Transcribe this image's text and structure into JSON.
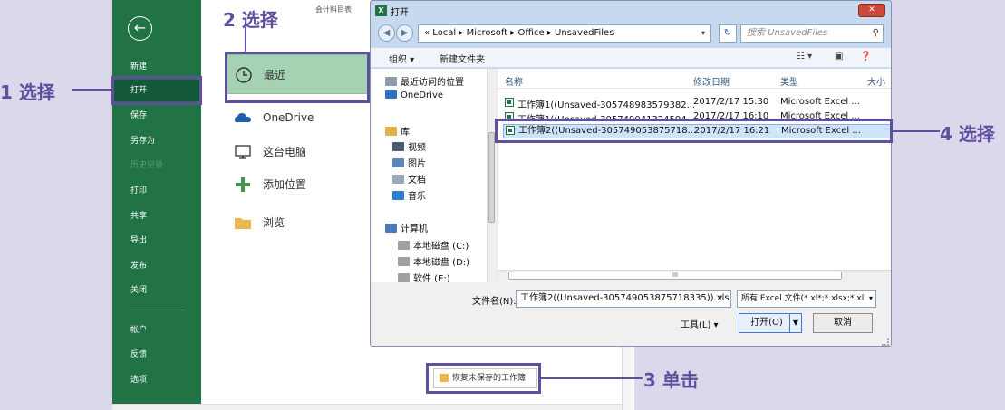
{
  "backstage": {
    "back_icon": "←",
    "nav": [
      "新建",
      "打开",
      "保存",
      "另存为",
      "历史记录",
      "打印",
      "共享",
      "导出",
      "发布",
      "关闭",
      "帐户",
      "反馈",
      "选项"
    ],
    "file_title": "会计科目表",
    "places": [
      {
        "label": "最近",
        "icon": "clock-icon"
      },
      {
        "label": "OneDrive",
        "icon": "cloud-icon"
      },
      {
        "label": "这台电脑",
        "icon": "computer-icon"
      },
      {
        "label": "添加位置",
        "icon": "plus-icon"
      },
      {
        "label": "浏览",
        "icon": "folder-icon"
      }
    ],
    "recover_button": "恢复未保存的工作簿"
  },
  "callouts": {
    "c1": "1 选择",
    "c2": "2 选择",
    "c3": "3 单击",
    "c4": "4 选择"
  },
  "dialog": {
    "title": "打开",
    "close": "✕",
    "address": "« Local ▸ Microsoft ▸ Office ▸ UnsavedFiles",
    "search_placeholder": "搜索 UnsavedFiles",
    "toolbar": {
      "organize": "组织 ▾",
      "new_folder": "新建文件夹"
    },
    "nav_tree": [
      {
        "label": "最近访问的位置",
        "color": "#8a9bb0"
      },
      {
        "label": "OneDrive",
        "color": "#2e6fbf"
      },
      {
        "label": "库",
        "color": "#e2b24a"
      },
      {
        "label": "视频",
        "color": "#4a5a70"
      },
      {
        "label": "图片",
        "color": "#5b88b8"
      },
      {
        "label": "文档",
        "color": "#9aa8b8"
      },
      {
        "label": "音乐",
        "color": "#2d7fd0"
      },
      {
        "label": "计算机",
        "color": "#4a7bbf"
      },
      {
        "label": "本地磁盘 (C:)",
        "color": "#a0a0a0"
      },
      {
        "label": "本地磁盘 (D:)",
        "color": "#a0a0a0"
      },
      {
        "label": "软件 (E:)",
        "color": "#a0a0a0"
      }
    ],
    "columns": {
      "name": "名称",
      "date": "修改日期",
      "type": "类型",
      "size": "大小"
    },
    "files": [
      {
        "name": "工作簿1((Unsaved-305748983579382...",
        "date": "2017/2/17 15:30",
        "type": "Microsoft Excel ..."
      },
      {
        "name": "工作簿1((Unsaved-305749041324594...",
        "date": "2017/2/17 16:10",
        "type": "Microsoft Excel ..."
      },
      {
        "name": "工作簿2((Unsaved-305749053875718...",
        "date": "2017/2/17 16:21",
        "type": "Microsoft Excel ..."
      }
    ],
    "hscroll_label": "III",
    "filename_label": "文件名(N):",
    "filename_value": "工作簿2((Unsaved-305749053875718335)).xlsb",
    "filetype": "所有 Excel 文件(*.xl*;*.xlsx;*.xl",
    "tools": "工具(L)",
    "open": "打开(O)",
    "cancel": "取消"
  }
}
